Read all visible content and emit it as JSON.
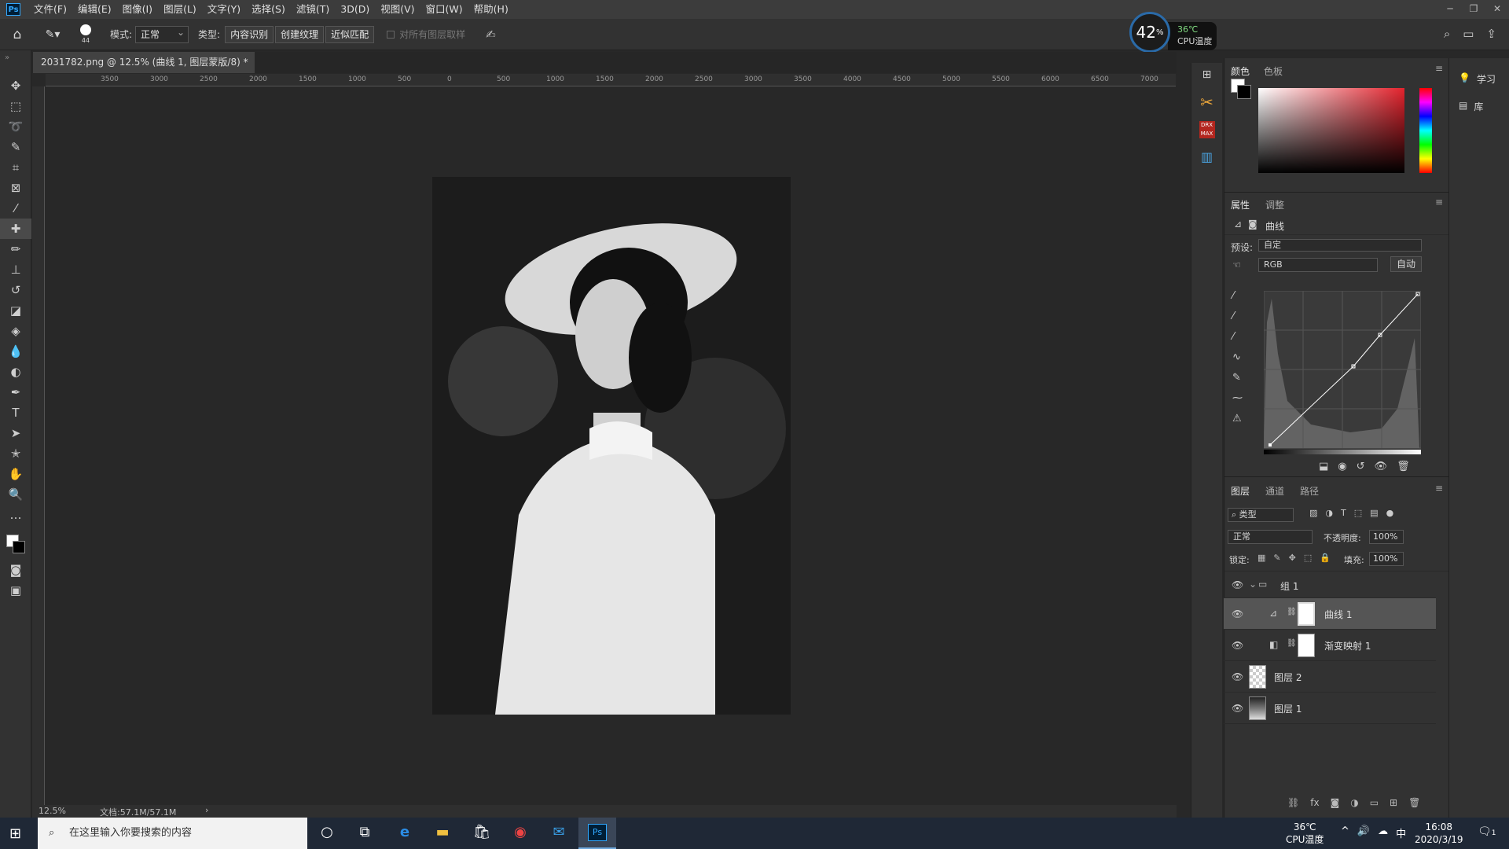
{
  "app": {
    "logo": "Ps"
  },
  "menu": [
    "文件(F)",
    "编辑(E)",
    "图像(I)",
    "图层(L)",
    "文字(Y)",
    "选择(S)",
    "滤镜(T)",
    "3D(D)",
    "视图(V)",
    "窗口(W)",
    "帮助(H)"
  ],
  "window_controls": [
    "minimize-icon",
    "restore-icon",
    "close-icon"
  ],
  "options": {
    "brush_size": "44",
    "mode_label": "模式:",
    "mode_value": "正常",
    "type_label": "类型:",
    "type_buttons": [
      "内容识别",
      "创建纹理",
      "近似匹配"
    ],
    "sample_all_label": "对所有图层取样"
  },
  "monitor": {
    "cpu_percent": "42",
    "percent_sign": "%",
    "temp": "36℃",
    "temp_label": "CPU温度"
  },
  "document": {
    "tab_title": "2031782.png @ 12.5% (曲线 1, 图层蒙版/8) *"
  },
  "ruler_labels": [
    "3500",
    "3000",
    "2500",
    "2000",
    "1500",
    "1000",
    "500",
    "0",
    "500",
    "1000",
    "1500",
    "2000",
    "2500",
    "3000",
    "3500",
    "4000",
    "4500",
    "5000",
    "5500",
    "6000",
    "6500",
    "7000"
  ],
  "status": {
    "zoom": "12.5%",
    "doc_info": "文档:57.1M/57.1M"
  },
  "color_panel": {
    "tabs": [
      "颜色",
      "色板"
    ]
  },
  "properties_panel": {
    "tabs": [
      "属性",
      "调整"
    ],
    "title": "曲线",
    "preset_label": "预设:",
    "preset_value": "自定",
    "channel": "RGB",
    "auto_button": "自动"
  },
  "layers_panel": {
    "tabs": [
      "图层",
      "通道",
      "路径"
    ],
    "filter_kind": "类型",
    "blend_mode": "正常",
    "opacity_label": "不透明度:",
    "opacity_value": "100%",
    "lock_label": "锁定:",
    "fill_label": "填充:",
    "fill_value": "100%",
    "layers": [
      {
        "name": "组 1"
      },
      {
        "name": "曲线 1"
      },
      {
        "name": "渐变映射 1"
      },
      {
        "name": "图层 2"
      },
      {
        "name": "图层 1"
      }
    ]
  },
  "learn_panel": {
    "learn": "学习",
    "library": "库"
  },
  "taskbar": {
    "search_placeholder": "在这里输入你要搜索的内容",
    "temp": "36℃",
    "temp_label": "CPU温度",
    "ime": "中",
    "time": "16:08",
    "date": "2020/3/19",
    "notification_count": "1"
  }
}
